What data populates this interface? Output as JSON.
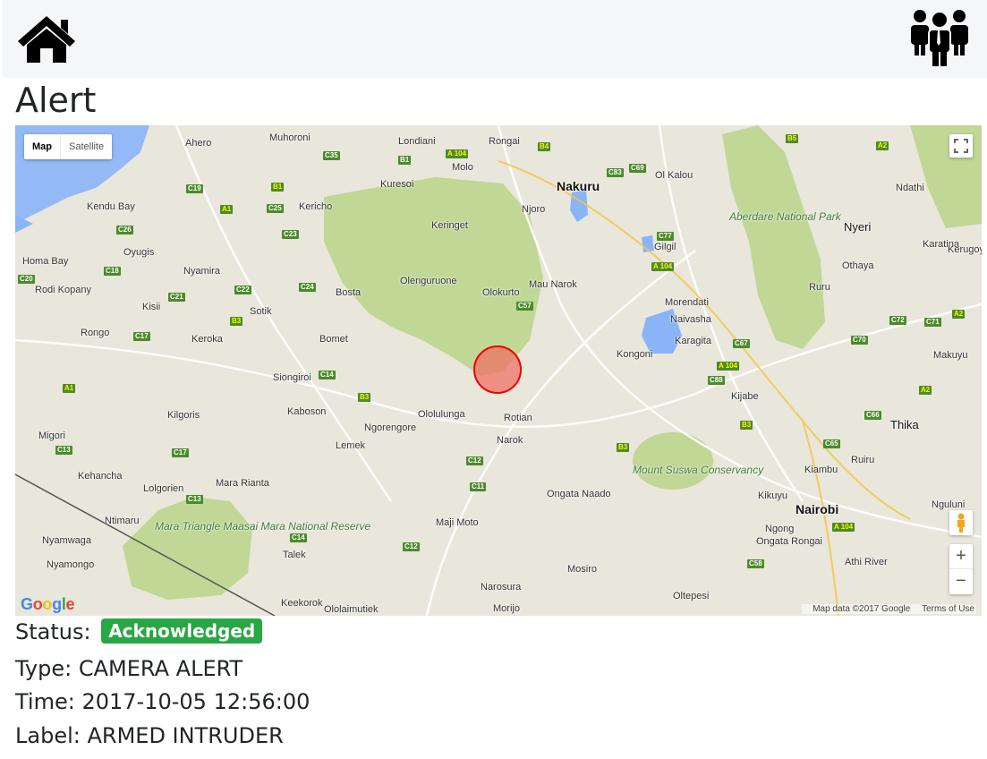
{
  "page": {
    "title": "Alert"
  },
  "nav": {
    "home_icon": "home-icon",
    "people_icon": "users-icon"
  },
  "map": {
    "type_map_label": "Map",
    "type_satellite_label": "Satellite",
    "google_logo": "Google",
    "attribution": "Map data ©2017 Google",
    "terms": "Terms of Use",
    "zoom_in": "+",
    "zoom_out": "−",
    "places": [
      "Ahero",
      "Muhoroni",
      "Londiani",
      "Rongai",
      "Molo",
      "Nakuru",
      "Ol Kalou",
      "Ndathi",
      "Kendu Bay",
      "Kuresoi",
      "Kericho",
      "Keringet",
      "Njoro",
      "Gilgil",
      "Nyeri",
      "Aberdare National Park",
      "Homa Bay",
      "Oyugis",
      "Nyamira",
      "Olenguruone",
      "Olokurto",
      "Mau Narok",
      "Karatina",
      "Kerugoya",
      "Othaya",
      "Rodi Kopany",
      "Bosta",
      "Kisii",
      "Sotik",
      "Morendati",
      "Naivasha",
      "Ruru",
      "Rongo",
      "Keroka",
      "Bomet",
      "Karagita",
      "Kongoni",
      "Makuyu",
      "Siongiroi",
      "Kijabe",
      "Kaboson",
      "Ololulunga",
      "Rotian",
      "Ngorengore",
      "Thika",
      "Kilgoris",
      "Migori",
      "Lemek",
      "Narok",
      "Ruiru",
      "Kehancha",
      "Mount Suswa Conservancy",
      "Kiambu",
      "Lolgorien",
      "Mara Rianta",
      "Ongata Naado",
      "Kikuyu",
      "Nguluni",
      "Ntimaru",
      "Maji Moto",
      "Nairobi",
      "Mara Triangle Maasai Mara National Reserve",
      "Ngong",
      "Ongata Rongai",
      "Nyamwaga",
      "Talek",
      "Athi River",
      "Nyamongo",
      "Mosiro",
      "Narosura",
      "Oltepesi",
      "Keekorok",
      "Ololaimutiek",
      "Morijo"
    ],
    "road_labels": [
      "C35",
      "B1",
      "A 104",
      "B4",
      "C83",
      "C69",
      "B5",
      "A2",
      "C19",
      "B1",
      "A1",
      "C25",
      "C26",
      "C23",
      "C77",
      "A 104",
      "C18",
      "C24",
      "C20",
      "C21",
      "C22",
      "C57",
      "B3",
      "C17",
      "C67",
      "A 104",
      "C88",
      "C70",
      "C72",
      "C71",
      "A2",
      "A1",
      "C14",
      "B3",
      "B3",
      "C66",
      "C65",
      "B3",
      "C13",
      "C17",
      "C12",
      "C11",
      "C13",
      "C14",
      "C12",
      "A 104",
      "C58",
      "A2"
    ]
  },
  "alert": {
    "status_label": "Status:",
    "status_value": "Acknowledged",
    "status_color": "#28a745",
    "type_label": "Type:",
    "type_value": "CAMERA ALERT",
    "time_label": "Time:",
    "time_value": "2017-10-05 12:56:00",
    "label_label": "Label:",
    "label_value": "ARMED INTRUDER"
  }
}
